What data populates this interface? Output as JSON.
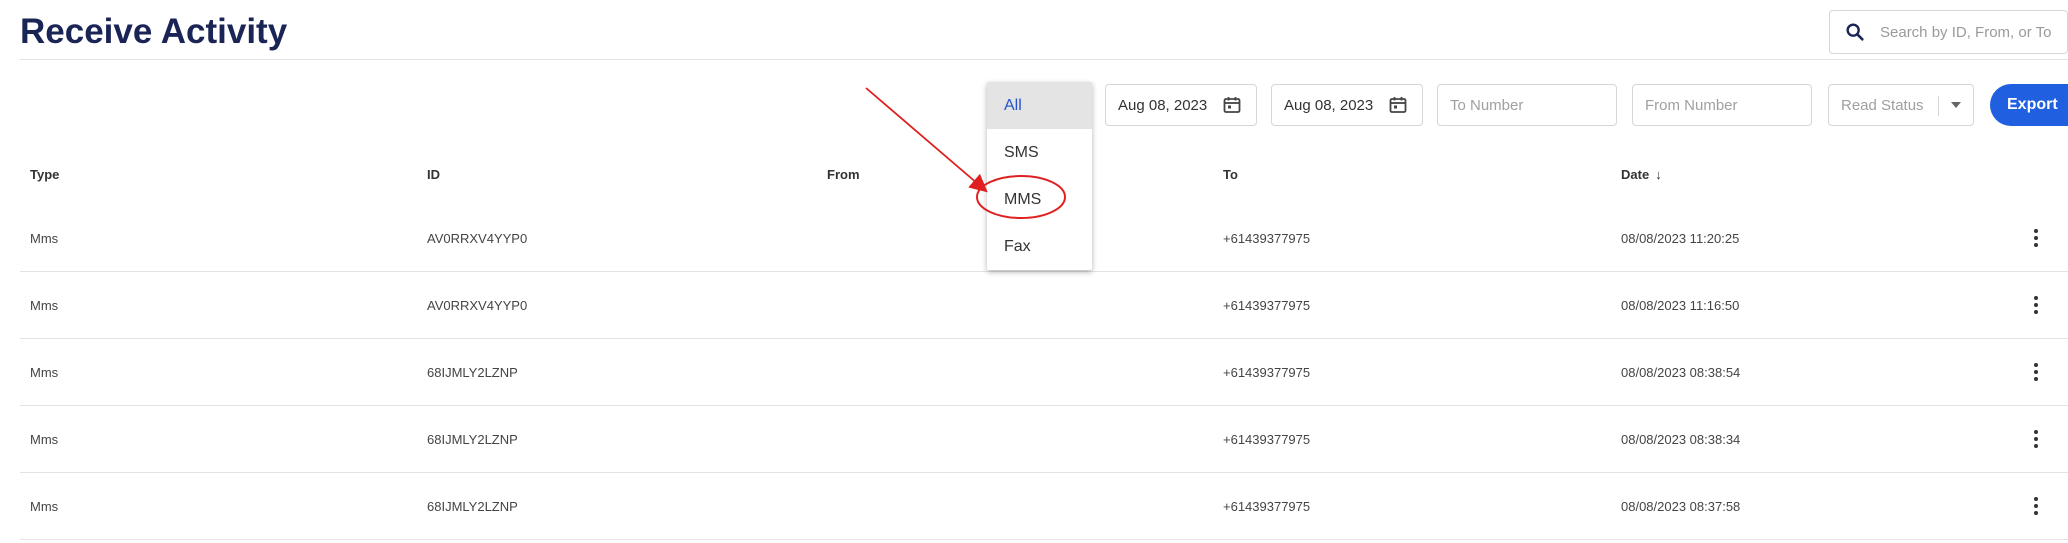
{
  "header": {
    "title": "Receive Activity",
    "search_placeholder": "Search by ID, From, or To"
  },
  "filters": {
    "start_date": "Aug 08, 2023",
    "end_date": "Aug 08, 2023",
    "to_placeholder": "To Number",
    "from_placeholder": "From Number",
    "read_status_placeholder": "Read Status",
    "export_label": "Export"
  },
  "type_dropdown": {
    "options": [
      "All",
      "SMS",
      "MMS",
      "Fax"
    ],
    "selected": "All"
  },
  "table": {
    "columns": [
      "Type",
      "ID",
      "From",
      "To",
      "Date"
    ],
    "sort_column": "Date",
    "sort_direction": "descending",
    "rows": [
      {
        "type": "Mms",
        "id": "AV0RRXV4YYP0",
        "from": "",
        "to": "+61439377975",
        "date": "08/08/2023 11:20:25"
      },
      {
        "type": "Mms",
        "id": "AV0RRXV4YYP0",
        "from": "",
        "to": "+61439377975",
        "date": "08/08/2023 11:16:50"
      },
      {
        "type": "Mms",
        "id": "68IJMLY2LZNP",
        "from": "",
        "to": "+61439377975",
        "date": "08/08/2023 08:38:54"
      },
      {
        "type": "Mms",
        "id": "68IJMLY2LZNP",
        "from": "",
        "to": "+61439377975",
        "date": "08/08/2023 08:38:34"
      },
      {
        "type": "Mms",
        "id": "68IJMLY2LZNP",
        "from": "",
        "to": "+61439377975",
        "date": "08/08/2023 08:37:58"
      }
    ]
  },
  "colors": {
    "title": "#1a2556",
    "accent": "#1f5fe0",
    "dropdown_selected_text": "#2453c8",
    "annotation": "#e02020"
  },
  "icons": [
    "search-icon",
    "calendar-icon",
    "chevron-down-icon",
    "sort-down-arrow-icon",
    "more-vertical-icon"
  ]
}
